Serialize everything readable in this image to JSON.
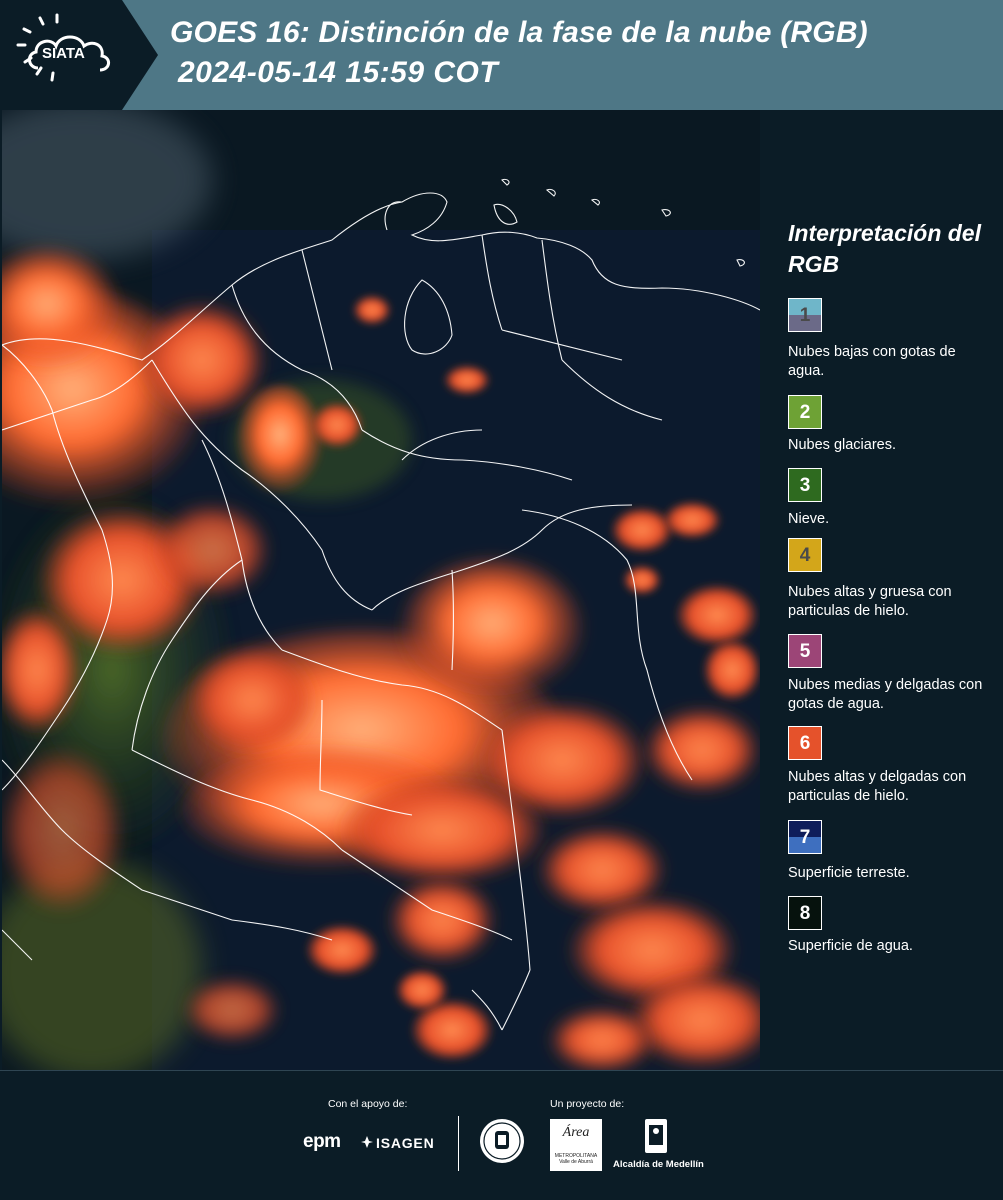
{
  "header": {
    "logo_text": "SIATA",
    "title": "GOES 16: Distinción de la fase de la nube (RGB)",
    "datetime": "2024-05-14 15:59 COT"
  },
  "map": {
    "background_color": "#07141c",
    "border_color": "#ffffff"
  },
  "legend": {
    "title": "Interpretación del RGB",
    "items": [
      {
        "number": "1",
        "label": "Nubes bajas con gotas de agua.",
        "colors": [
          "#6fb6c9",
          "#6b6a88"
        ]
      },
      {
        "number": "2",
        "label": "Nubes glaciares.",
        "colors": [
          "#6ea235"
        ]
      },
      {
        "number": "3",
        "label": "Nieve.",
        "colors": [
          "#2e6a1f"
        ]
      },
      {
        "number": "4",
        "label": "Nubes altas y gruesa con particulas de hielo.",
        "colors": [
          "#d3a61a"
        ]
      },
      {
        "number": "5",
        "label": "Nubes medias y delgadas con gotas de agua.",
        "colors": [
          "#9c4577"
        ]
      },
      {
        "number": "6",
        "label": "Nubes altas y delgadas con particulas de hielo.",
        "colors": [
          "#e5522b"
        ]
      },
      {
        "number": "7",
        "label": "Superficie terreste.",
        "colors": [
          "#0f1d5a",
          "#3e6fbf"
        ]
      },
      {
        "number": "8",
        "label": "Superficie de agua.",
        "colors": [
          "#06120d"
        ]
      }
    ]
  },
  "footer": {
    "support_label": "Con el apoyo de:",
    "project_label": "Un proyecto de:",
    "sponsors": [
      "epm",
      "ISAGEN"
    ],
    "area_logo_text": "Área",
    "area_logo_sub": "METROPOLITANA Valle de Aburrá",
    "alcaldia_text": "Alcaldía de Medellín"
  }
}
